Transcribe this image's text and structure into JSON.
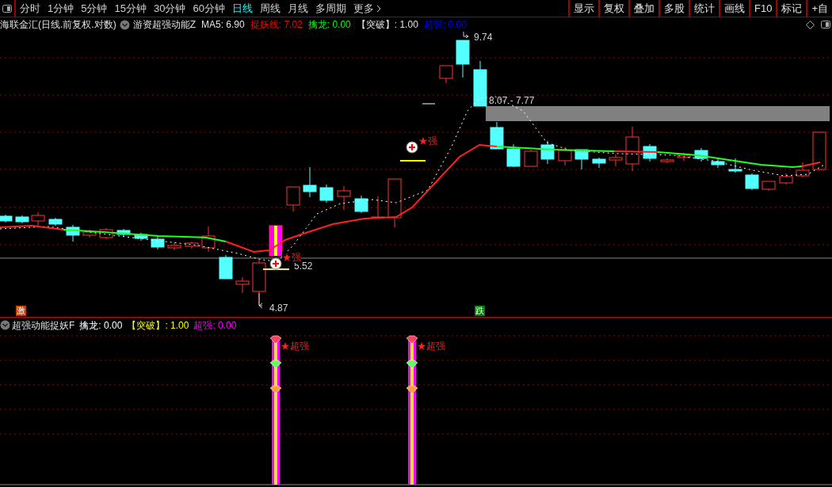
{
  "toolbar": {
    "tabs": [
      {
        "label": "分时",
        "selected": false
      },
      {
        "label": "1分钟",
        "selected": false
      },
      {
        "label": "5分钟",
        "selected": false
      },
      {
        "label": "15分钟",
        "selected": false
      },
      {
        "label": "30分钟",
        "selected": false
      },
      {
        "label": "60分钟",
        "selected": false
      },
      {
        "label": "日线",
        "selected": true
      },
      {
        "label": "周线",
        "selected": false
      },
      {
        "label": "月线",
        "selected": false
      },
      {
        "label": "多周期",
        "selected": false
      }
    ],
    "more": "更多",
    "buttons": [
      "显示",
      "复权",
      "叠加",
      "多股",
      "统计",
      "画线",
      "F10",
      "标记",
      "+自"
    ]
  },
  "main_header": {
    "stock": "海联金汇(日线.前复权.对数)",
    "indicator": "游资超强动能Z",
    "values": [
      {
        "text": "MA5: 6.90",
        "kind": "plain"
      },
      {
        "text": "捉妖线: 7.02",
        "kind": "red"
      },
      {
        "text": "擒龙: 0.00",
        "kind": "green"
      },
      {
        "text": "【突破】: 1.00",
        "kind": "plain"
      },
      {
        "text": "超强: 0.00",
        "kind": "blue"
      }
    ]
  },
  "main_chart": {
    "high_label": "9.74",
    "range_label": "8.07 - 7.77",
    "low_range_label": "5.52",
    "low_label": "4.87",
    "signals": [
      "★强",
      "★强"
    ],
    "badges": [
      {
        "text": "激",
        "color": "#c04000"
      },
      {
        "text": "跌",
        "color": "#008000"
      }
    ]
  },
  "sub_header": {
    "indicator": "超强动能捉妖F",
    "values": [
      {
        "text": "擒龙: 0.00",
        "kind": "white"
      },
      {
        "text": "【突破】: 1.00",
        "kind": "yellow"
      },
      {
        "text": "超强: 0.00",
        "kind": "magenta"
      }
    ]
  },
  "sub_chart": {
    "signals": [
      "★超强",
      "★超强"
    ]
  }
}
